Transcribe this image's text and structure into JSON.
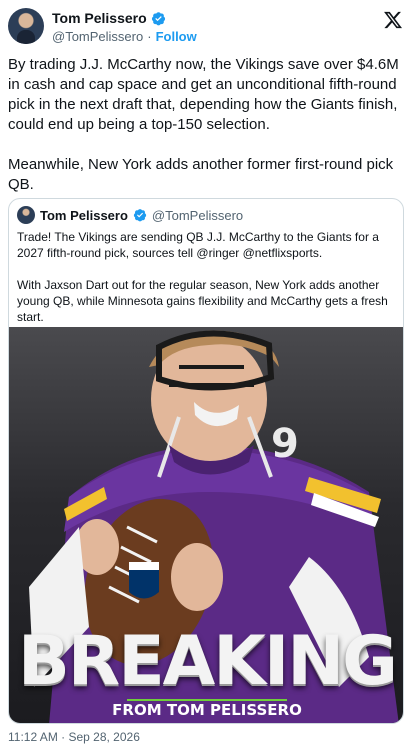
{
  "author": {
    "name": "Tom Pelissero",
    "handle": "@TomPelissero",
    "separator": "·",
    "follow_label": "Follow"
  },
  "tweet": {
    "paragraphs": [
      "By trading J.J. McCarthy now, the Vikings save over $4.6M in cash and cap space and get an unconditional fifth-round pick in the next draft that, depending how the Giants finish, could end up being a top-150 selection.",
      "Meanwhile, New York adds another former first-round pick QB."
    ],
    "timestamp": "11:12 AM · Sep 28, 2026"
  },
  "quote": {
    "name": "Tom Pelissero",
    "handle": "@TomPelissero",
    "paragraphs": [
      "Trade! The Vikings are sending QB J.J. McCarthy to the Giants for a 2027 fifth-round pick, sources tell @ringer @netflixsports.",
      "With Jaxson Dart out for the regular season, New York adds another young QB, while Minnesota gains flexibility and McCarthy gets a fresh start."
    ],
    "media": {
      "headline": "BREAKING",
      "subline": "FROM TOM PELISSERO"
    }
  },
  "colors": {
    "accent": "#1d9bf0",
    "muted": "#536471",
    "jersey_purple": "#5b2a86",
    "jersey_gold": "#f2c12e",
    "subline_green": "#6fcf3a"
  },
  "icons": {
    "verified": "verified-badge-icon",
    "brand": "x-logo-icon"
  }
}
